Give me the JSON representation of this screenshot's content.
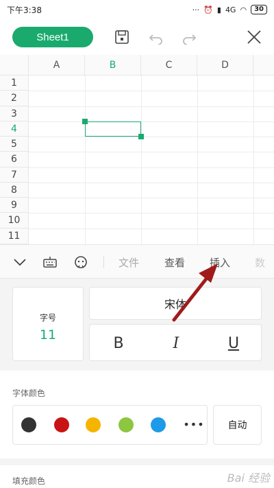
{
  "status_bar": {
    "time": "下午3:38",
    "network": "4G",
    "battery": "30"
  },
  "toolbar": {
    "sheet_label": "Sheet1"
  },
  "grid": {
    "columns": [
      "A",
      "B",
      "C",
      "D"
    ],
    "rows": [
      "1",
      "2",
      "3",
      "4",
      "5",
      "6",
      "7",
      "8",
      "9",
      "10",
      "11"
    ],
    "active_column": "B",
    "active_row": "4"
  },
  "tabs": {
    "file": "文件",
    "view": "查看",
    "insert": "插入",
    "data": "数"
  },
  "font_panel": {
    "size_label": "字号",
    "size_value": "11",
    "font_name": "宋体",
    "bold": "B",
    "italic": "I",
    "underline": "U"
  },
  "font_color": {
    "title": "字体颜色",
    "swatches": [
      "#333333",
      "#c81414",
      "#f5b400",
      "#8dc63f",
      "#1e9be8"
    ],
    "auto_label": "自动"
  },
  "fill_color": {
    "title": "填充颜色"
  },
  "watermark": "Bai 经验"
}
